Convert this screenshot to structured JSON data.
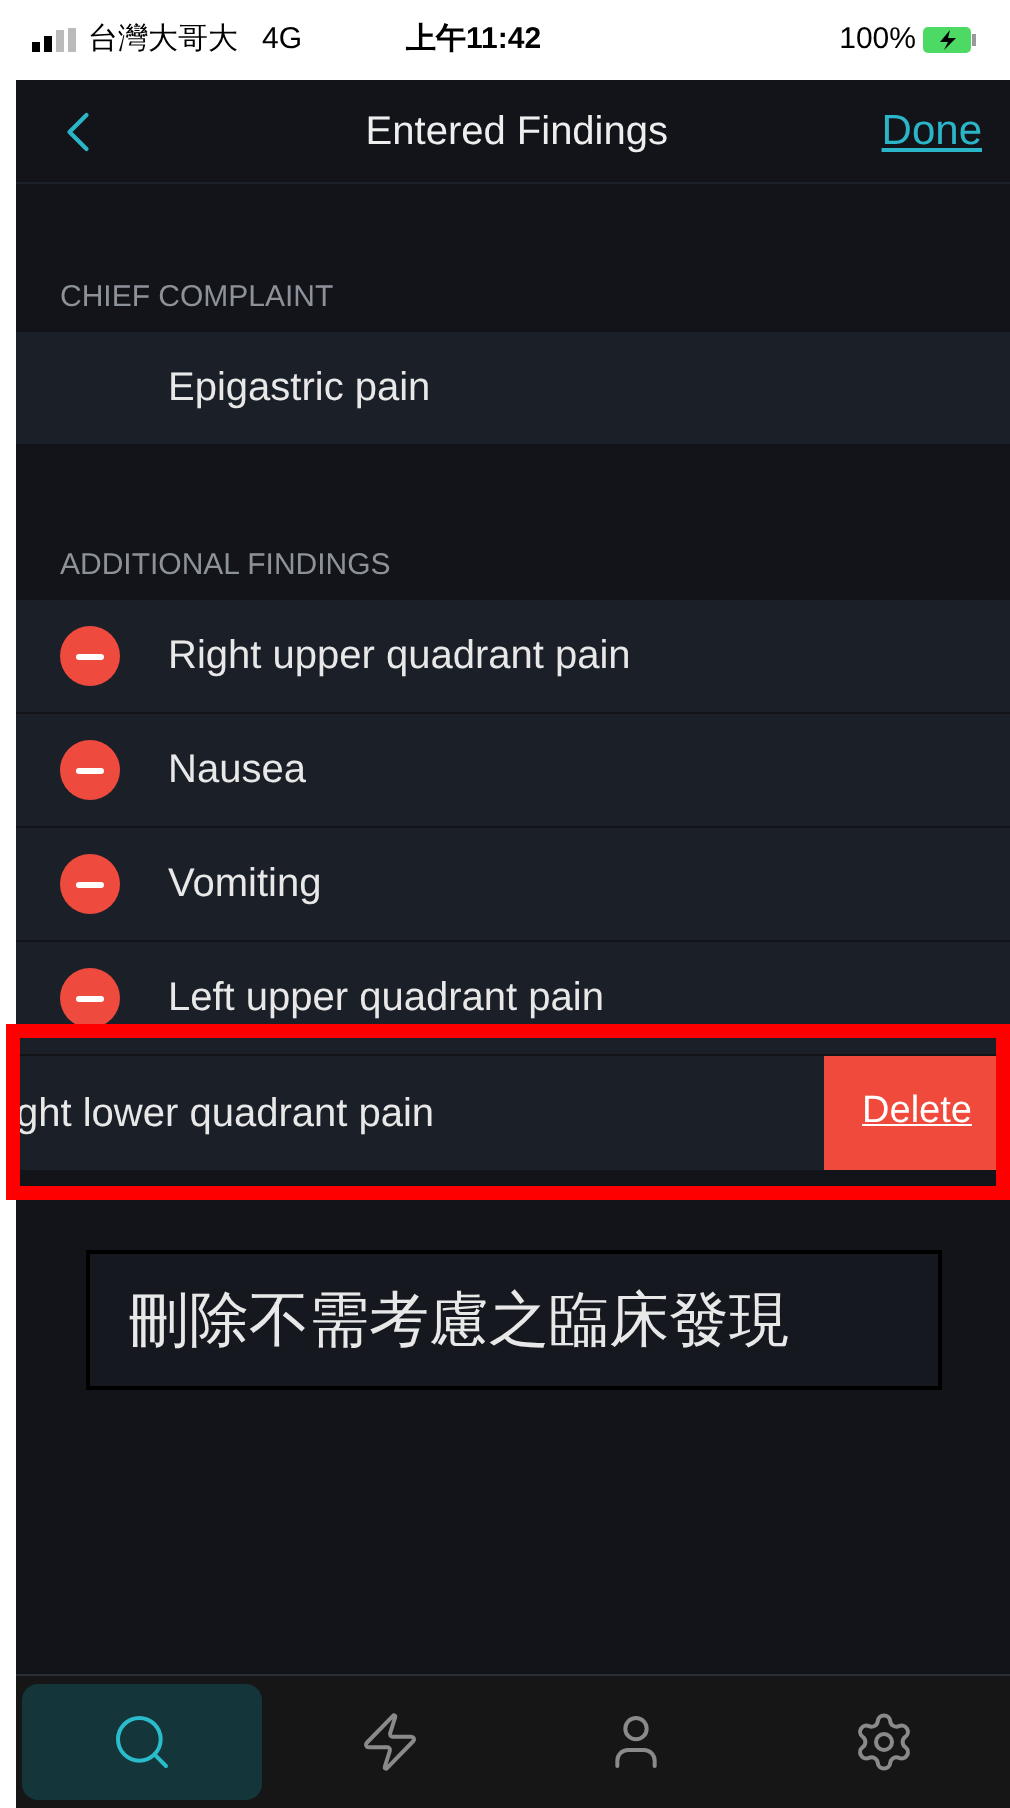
{
  "status_bar": {
    "carrier": "台灣大哥大",
    "network": "4G",
    "time": "上午11:42",
    "battery": "100%"
  },
  "nav": {
    "title": "Entered Findings",
    "done": "Done"
  },
  "sections": [
    {
      "header": "CHIEF COMPLAINT",
      "items": [
        {
          "label": "Epigastric pain",
          "kind": "fixed"
        }
      ]
    },
    {
      "header": "ADDITIONAL FINDINGS",
      "items": [
        {
          "label": "Right upper quadrant pain",
          "kind": "removable"
        },
        {
          "label": "Nausea",
          "kind": "removable"
        },
        {
          "label": "Vomiting",
          "kind": "removable"
        },
        {
          "label": "Left upper quadrant pain",
          "kind": "removable"
        },
        {
          "label": "ght lower quadrant pain",
          "kind": "swiped",
          "action": "Delete"
        }
      ]
    }
  ],
  "annotation": {
    "caption": "刪除不需考慮之臨床發現"
  },
  "tabs": [
    {
      "selected": true
    },
    {
      "selected": false
    },
    {
      "selected": false
    },
    {
      "selected": false
    }
  ]
}
